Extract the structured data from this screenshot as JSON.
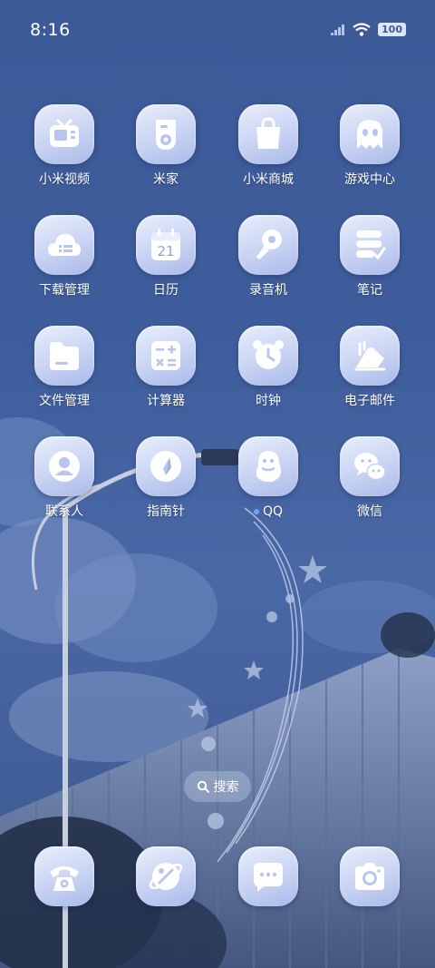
{
  "status_bar": {
    "time": "8:16",
    "battery": "100"
  },
  "apps": [
    {
      "label": "小米视频",
      "icon": "tv-icon"
    },
    {
      "label": "米家",
      "icon": "mijia-speaker-icon"
    },
    {
      "label": "小米商城",
      "icon": "shopping-bag-icon"
    },
    {
      "label": "游戏中心",
      "icon": "ghost-icon"
    },
    {
      "label": "下载管理",
      "icon": "cloud-download-icon"
    },
    {
      "label": "日历",
      "icon": "calendar-icon",
      "date": "21"
    },
    {
      "label": "录音机",
      "icon": "microphone-icon"
    },
    {
      "label": "笔记",
      "icon": "notes-icon"
    },
    {
      "label": "文件管理",
      "icon": "folder-icon"
    },
    {
      "label": "计算器",
      "icon": "calculator-icon"
    },
    {
      "label": "时钟",
      "icon": "alarm-clock-icon"
    },
    {
      "label": "电子邮件",
      "icon": "mail-icon"
    },
    {
      "label": "联系人",
      "icon": "contact-icon"
    },
    {
      "label": "指南针",
      "icon": "compass-icon"
    },
    {
      "label": "QQ",
      "icon": "penguin-icon"
    },
    {
      "label": "微信",
      "icon": "wechat-icon"
    }
  ],
  "search": {
    "label": "搜索",
    "icon": "search-icon"
  },
  "dock": [
    {
      "icon": "phone-icon"
    },
    {
      "icon": "browser-planet-icon"
    },
    {
      "icon": "message-icon"
    },
    {
      "icon": "camera-icon"
    }
  ],
  "colors": {
    "background": "#3f5d9c",
    "tile": "#c8d3f3",
    "glyph": "#ffffff"
  }
}
